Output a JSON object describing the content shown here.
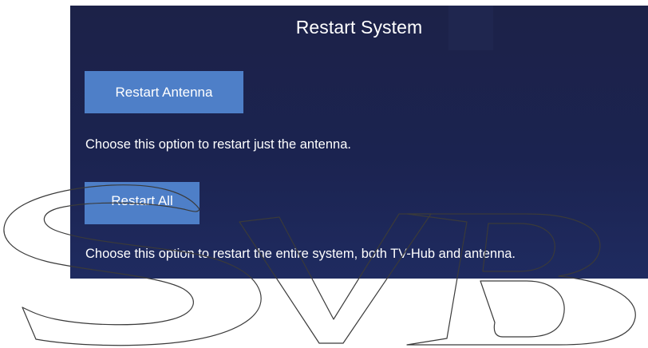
{
  "dialog": {
    "title": "Restart System",
    "antenna_button_label": "Restart Antenna",
    "antenna_description": "Choose this option to restart just the antenna.",
    "all_button_label": "Restart All",
    "all_description": "Choose this option to restart the entire system, both TV-Hub and antenna."
  },
  "watermark": {
    "text": "SVB",
    "kind": "outlined-logo-letters"
  },
  "colors": {
    "panel_background": "#1c2248",
    "button_background": "#4e7fc8",
    "text": "#ffffff",
    "watermark_stroke": "#3a3a3a"
  }
}
